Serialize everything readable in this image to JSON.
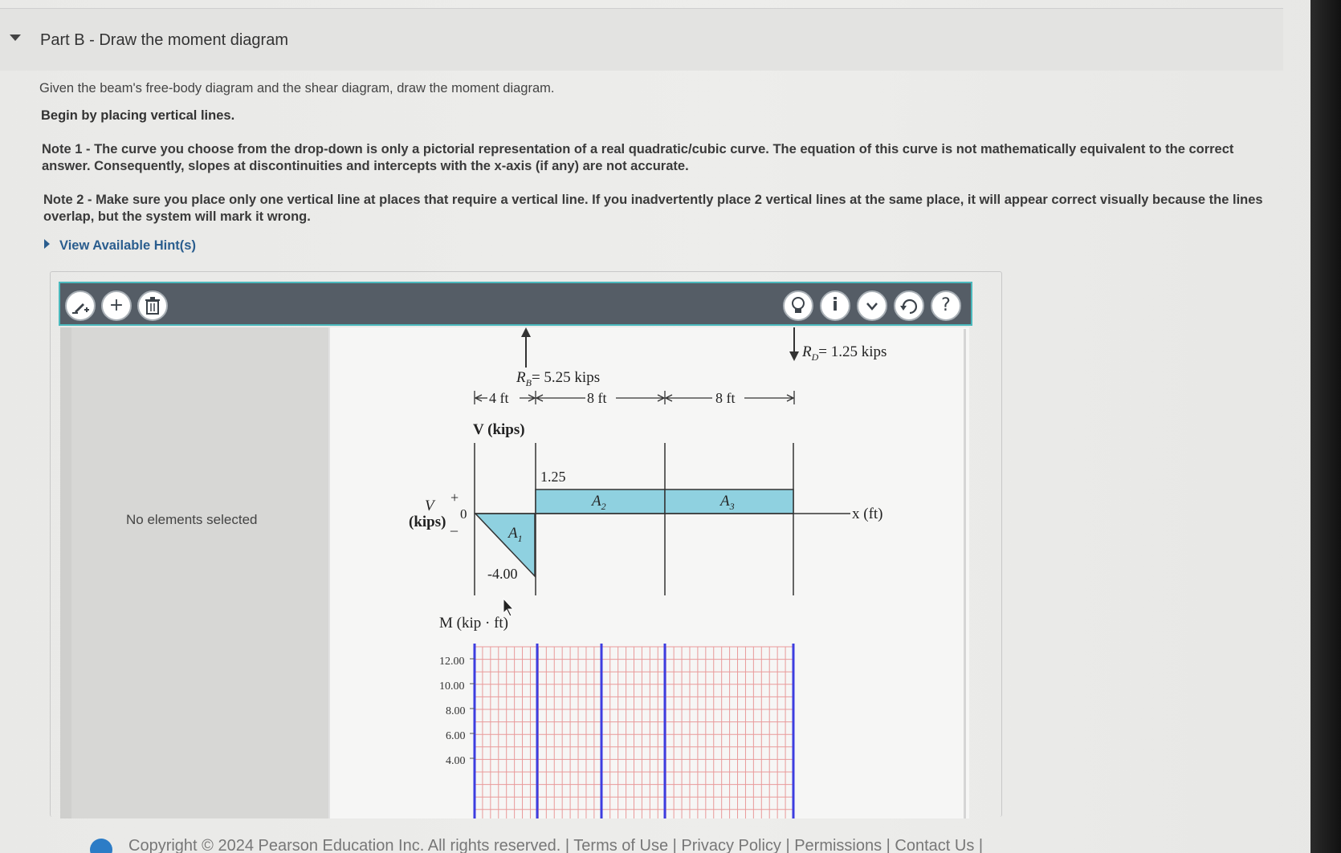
{
  "part": {
    "title": "Part B - Draw the moment diagram"
  },
  "instructions": {
    "intro": "Given the beam's free-body diagram and the shear diagram, draw the moment diagram.",
    "begin": "Begin by placing vertical lines.",
    "note1": "Note 1 - The curve you choose from the drop-down is only a pictorial representation of a real quadratic/cubic curve. The equation of this curve is not mathematically equivalent to the correct answer. Consequently, slopes at discontinuities and intercepts with the x-axis (if any) are not accurate.",
    "note2": "Note 2 - Make sure you place only one vertical line at places that require a vertical line. If you inadvertently place 2 vertical lines at the same place, it will appear correct visually because the lines overlap, but the system will mark it wrong.",
    "hints_link": "View Available Hint(s)"
  },
  "toolbar": {
    "left_buttons": [
      "draw-tool",
      "add",
      "delete"
    ],
    "right_buttons": [
      "hint",
      "info",
      "dropdown",
      "reset",
      "help"
    ]
  },
  "side_panel": {
    "status": "No elements selected"
  },
  "fbd": {
    "rb_label": "R",
    "rb_sub": "B",
    "rb_value": "= 5.25 kips",
    "rd_label": "R",
    "rd_sub": "D",
    "rd_value": "= 1.25 kips",
    "span1": "4 ft",
    "span2": "8 ft",
    "span3": "8 ft"
  },
  "shear": {
    "title": "V (kips)",
    "axis_v": "V",
    "axis_units": "(kips)",
    "plus": "+",
    "zero": "0",
    "minus": "_",
    "x_label": "x (ft)",
    "value_pos": "1.25",
    "value_neg": "-4.00",
    "area1": "A",
    "area1_sub": "1",
    "area2": "A",
    "area2_sub": "2",
    "area3": "A",
    "area3_sub": "3",
    "fill_color": "#8fd1e0"
  },
  "moment": {
    "title": "M (kip · ft)",
    "y_ticks": [
      "12.00",
      "10.00",
      "8.00",
      "6.00",
      "4.00"
    ],
    "grid_color": "#e99a9a",
    "vline_color": "#3d3de0"
  },
  "footer": {
    "text": "Copyright © 2024 Pearson Education Inc. All rights reserved. | Terms of Use | Privacy Policy | Permissions | Contact Us |"
  }
}
